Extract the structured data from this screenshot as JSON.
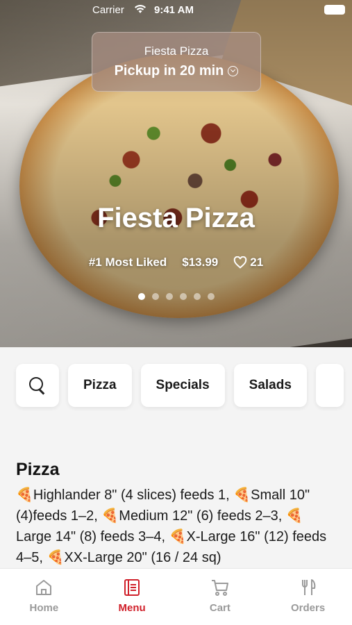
{
  "status_bar": {
    "carrier": "Carrier",
    "time": "9:41 AM"
  },
  "pickup": {
    "store": "Fiesta Pizza",
    "time_label": "Pickup in 20 min"
  },
  "hero": {
    "title": "Fiesta Pizza",
    "badge": "#1 Most Liked",
    "price": "$13.99",
    "likes": "21",
    "slides_total": 6,
    "slide_active": 1
  },
  "categories": [
    {
      "label": "Pizza"
    },
    {
      "label": "Specials"
    },
    {
      "label": "Salads"
    }
  ],
  "section": {
    "title": "Pizza",
    "description": "🍕Highlander 8\" (4 slices) feeds 1, 🍕Small 10\" (4)feeds 1–2, 🍕Medium 12\" (6) feeds 2–3, 🍕Large 14\" (8) feeds 3–4, 🍕X-Large 16\" (12) feeds 4–5, 🍕XX-Large 20\" (16 / 24 sq)"
  },
  "tabs": [
    {
      "label": "Home",
      "icon": "home-icon"
    },
    {
      "label": "Menu",
      "icon": "menu-icon",
      "active": true
    },
    {
      "label": "Cart",
      "icon": "cart-icon"
    },
    {
      "label": "Orders",
      "icon": "fork-knife-icon"
    }
  ],
  "colors": {
    "accent": "#d0202a",
    "tab_inactive": "#9a9a9a"
  }
}
